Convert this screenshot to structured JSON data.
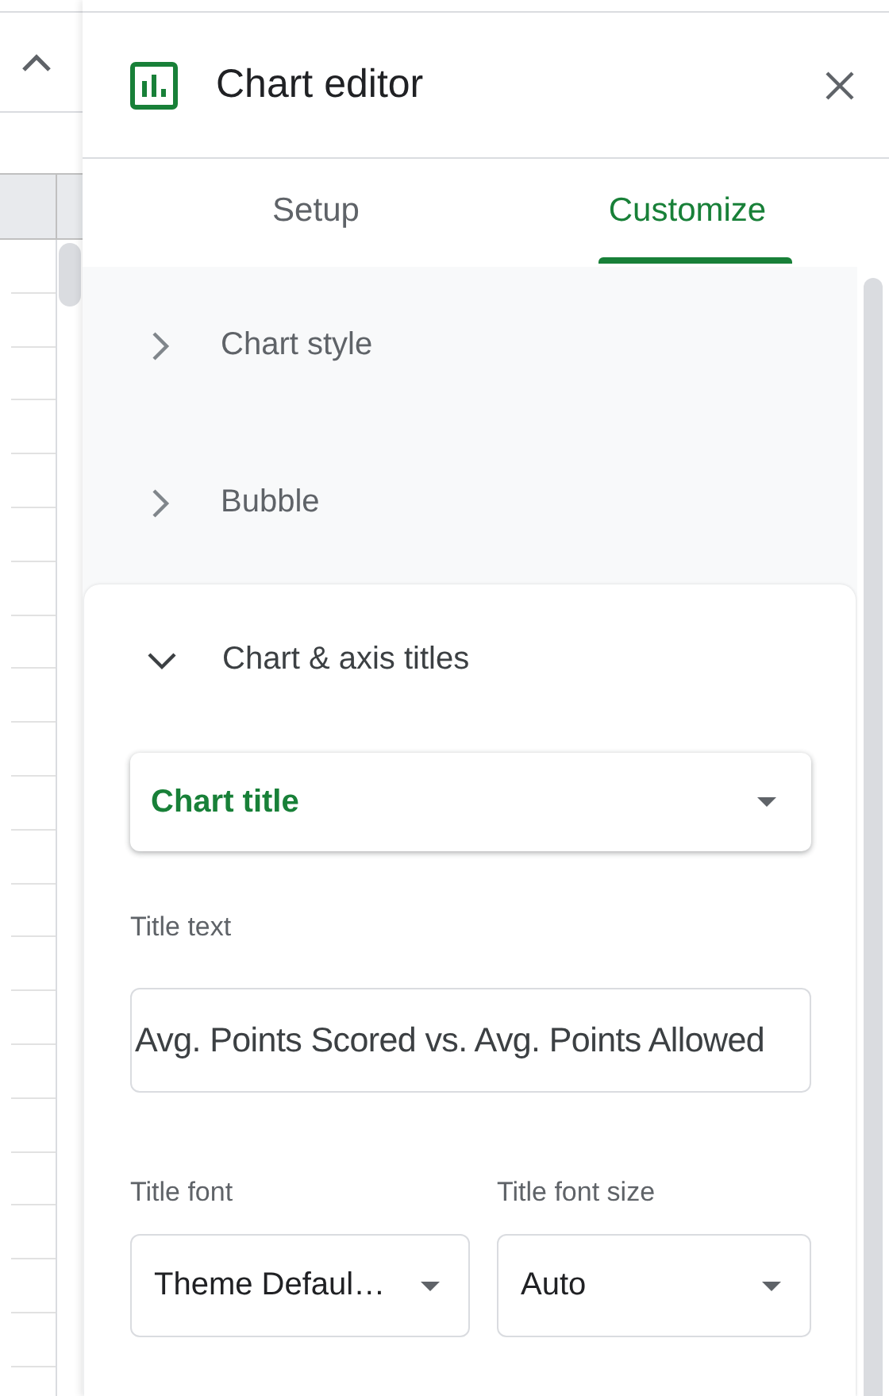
{
  "window": {
    "title": "Chart editor"
  },
  "tabs": [
    {
      "label": "Setup",
      "selected": false
    },
    {
      "label": "Customize",
      "selected": true
    }
  ],
  "sections": [
    {
      "title": "Chart style",
      "expanded": false
    },
    {
      "title": "Bubble",
      "expanded": false
    },
    {
      "title": "Chart & axis titles",
      "expanded": true
    }
  ],
  "title_type_dropdown": {
    "value": "Chart title"
  },
  "title_text": {
    "label": "Title text",
    "value": "Avg. Points Scored vs. Avg. Points Allowed"
  },
  "title_font": {
    "label": "Title font",
    "value": "Theme Defaul…"
  },
  "title_font_size": {
    "label": "Title font size",
    "value": "Auto"
  }
}
